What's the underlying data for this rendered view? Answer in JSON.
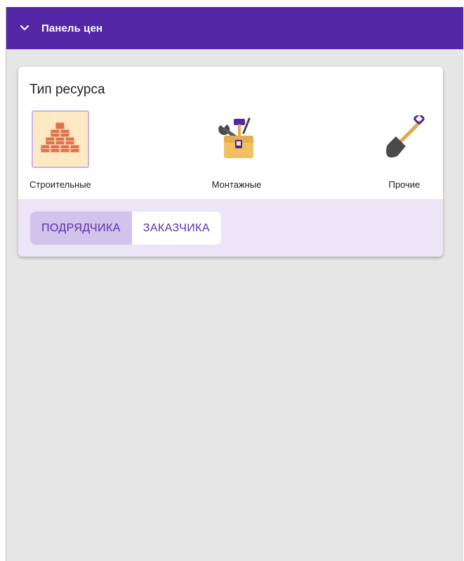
{
  "header": {
    "title": "Панель цен",
    "icon": "chevron-down-icon"
  },
  "card": {
    "title": "Тип ресурса",
    "resources": [
      {
        "label": "Строительные",
        "icon": "bricks-icon",
        "selected": true
      },
      {
        "label": "Монтажные",
        "icon": "toolbox-icon",
        "selected": false
      },
      {
        "label": "Прочие",
        "icon": "shovel-icon",
        "selected": false
      }
    ],
    "toggle": [
      {
        "label": "ПОДРЯДЧИКА",
        "active": true
      },
      {
        "label": "ЗАКАЗЧИКА",
        "active": false
      }
    ]
  },
  "colors": {
    "header_bg": "#5427a6",
    "accent_text": "#5b2fb0",
    "toggle_active_bg": "#d2c3ea",
    "card_bottom_bg": "#ece5f5",
    "selected_icon_bg": "#fde9c3"
  }
}
